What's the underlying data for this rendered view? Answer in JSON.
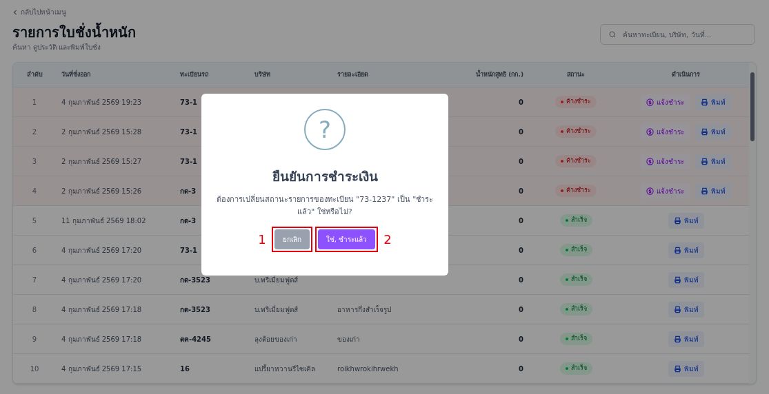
{
  "back_link": "กลับไปหน้าเมนู",
  "title": "รายการใบชั่งน้ำหนัก",
  "subtitle": "ค้นหา ดูประวัติ และพิมพ์ใบชั่ง",
  "search": {
    "placeholder": "ค้นหาทะเบียน, บริษัท, วันที่..."
  },
  "table": {
    "columns": [
      "ลำดับ",
      "วันที่ชั่งออก",
      "ทะเบียนรถ",
      "บริษัท",
      "รายละเอียด",
      "น้ำหนักสุทธิ (กก.)",
      "สถานะ",
      "ดำเนินการ"
    ],
    "rows": [
      {
        "no": "1",
        "date": "4 กุมภาพันธ์ 2569 19:23",
        "plate": "73-1",
        "weight": "0",
        "status": {
          "kind": "pending",
          "label": "ค้างชำระ"
        },
        "actions": [
          {
            "kind": "pay",
            "label": "แจ้งชำระ"
          },
          {
            "kind": "print",
            "label": "พิมพ์"
          }
        ]
      },
      {
        "no": "2",
        "date": "2 กุมภาพันธ์ 2569 15:28",
        "plate": "73-1",
        "weight": "0",
        "status": {
          "kind": "pending",
          "label": "ค้างชำระ"
        },
        "actions": [
          {
            "kind": "pay",
            "label": "แจ้งชำระ"
          },
          {
            "kind": "print",
            "label": "พิมพ์"
          }
        ]
      },
      {
        "no": "3",
        "date": "2 กุมภาพันธ์ 2569 15:27",
        "plate": "73-1",
        "weight": "0",
        "status": {
          "kind": "pending",
          "label": "ค้างชำระ"
        },
        "actions": [
          {
            "kind": "pay",
            "label": "แจ้งชำระ"
          },
          {
            "kind": "print",
            "label": "พิมพ์"
          }
        ]
      },
      {
        "no": "4",
        "date": "2 กุมภาพันธ์ 2569 15:26",
        "plate": "กด-3",
        "weight": "0",
        "status": {
          "kind": "pending",
          "label": "ค้างชำระ"
        },
        "actions": [
          {
            "kind": "pay",
            "label": "แจ้งชำระ"
          },
          {
            "kind": "print",
            "label": "พิมพ์"
          }
        ]
      },
      {
        "no": "5",
        "date": "11 กุมภาพันธ์ 2569 18:02",
        "plate": "กด-3",
        "weight": "0",
        "status": {
          "kind": "paid",
          "label": "สำเร็จ"
        },
        "actions": [
          {
            "kind": "print",
            "label": "พิมพ์"
          }
        ]
      },
      {
        "no": "6",
        "date": "4 กุมภาพันธ์ 2569 17:20",
        "plate": "73-1",
        "weight": "0",
        "status": {
          "kind": "paid",
          "label": "สำเร็จ"
        },
        "actions": [
          {
            "kind": "print",
            "label": "พิมพ์"
          }
        ]
      },
      {
        "no": "7",
        "date": "4 กุมภาพันธ์ 2569 17:20",
        "plate": "กด-3523",
        "company": "บ.พรีเมี่ยมฟูดส์",
        "weight": "0",
        "status": {
          "kind": "paid",
          "label": "สำเร็จ"
        },
        "actions": [
          {
            "kind": "print",
            "label": "พิมพ์"
          }
        ]
      },
      {
        "no": "8",
        "date": "4 กุมภาพันธ์ 2569 17:18",
        "plate": "กด-3523",
        "company": "บ.พรีเมี่ยมฟูดส์",
        "detail": "อาหารกึ่งสำเร็จรูป",
        "weight": "0",
        "status": {
          "kind": "paid",
          "label": "สำเร็จ"
        },
        "actions": [
          {
            "kind": "print",
            "label": "พิมพ์"
          }
        ]
      },
      {
        "no": "9",
        "date": "4 กุมภาพันธ์ 2569 17:18",
        "plate": "ตค-4245",
        "company": "ลุงต้อยของเก่า",
        "detail": "ของเก่า",
        "weight": "0",
        "status": {
          "kind": "paid",
          "label": "สำเร็จ"
        },
        "actions": [
          {
            "kind": "print",
            "label": "พิมพ์"
          }
        ]
      },
      {
        "no": "10",
        "date": "4 กุมภาพันธ์ 2569 17:15",
        "plate": "16",
        "company": "แปรี้ยาหวานรีไซเคิล",
        "detail": "roikhwrokihrwekh",
        "weight": "0",
        "status": {
          "kind": "paid",
          "label": "สำเร็จ"
        },
        "actions": [
          {
            "kind": "print",
            "label": "พิมพ์"
          }
        ]
      }
    ]
  },
  "dialog": {
    "icon": "?",
    "title": "ยืนยันการชำระเงิน",
    "message": "ต้องการเปลี่ยนสถานะรายการของทะเบียน \"73-1237\" เป็น \"ชำระแล้ว\" ใช่หรือไม่?",
    "buttons": [
      {
        "kind": "cancel",
        "label": "ยกเลิก",
        "marker": "1"
      },
      {
        "kind": "confirm",
        "label": "ใช่, ชำระแล้ว",
        "marker": "2"
      }
    ]
  }
}
